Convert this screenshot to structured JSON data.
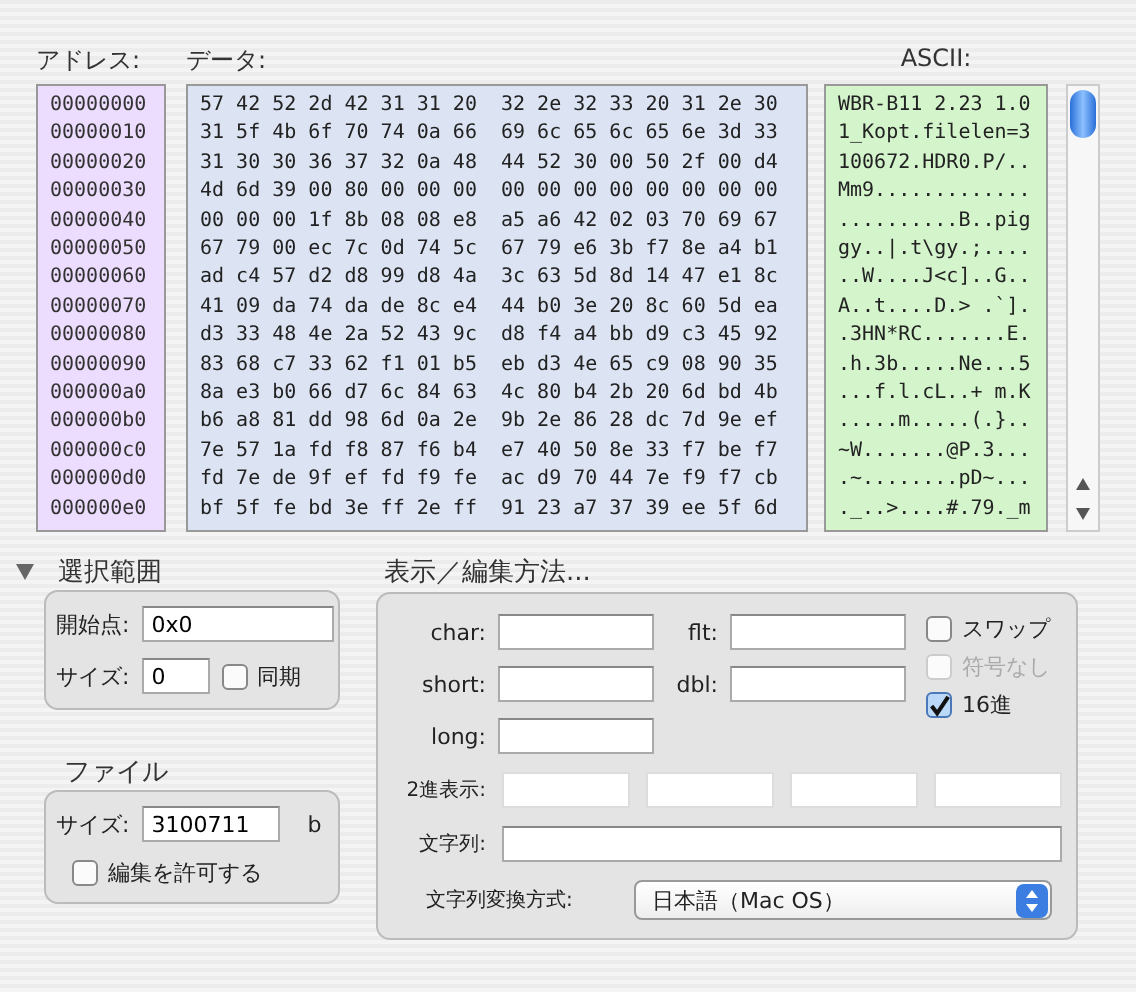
{
  "columns": {
    "address": "アドレス:",
    "data": "データ:",
    "ascii": "ASCII:"
  },
  "rows": [
    {
      "address": "00000000",
      "hex": [
        "57 42 52 2d 42 31 31 20",
        "32 2e 32 33 20 31 2e 30"
      ],
      "ascii": "WBR-B11 2.23 1.0"
    },
    {
      "address": "00000010",
      "hex": [
        "31 5f 4b 6f 70 74 0a 66",
        "69 6c 65 6c 65 6e 3d 33"
      ],
      "ascii": "1_Kopt.filelen=3"
    },
    {
      "address": "00000020",
      "hex": [
        "31 30 30 36 37 32 0a 48",
        "44 52 30 00 50 2f 00 d4"
      ],
      "ascii": "100672.HDR0.P/.."
    },
    {
      "address": "00000030",
      "hex": [
        "4d 6d 39 00 80 00 00 00",
        "00 00 00 00 00 00 00 00"
      ],
      "ascii": "Mm9............."
    },
    {
      "address": "00000040",
      "hex": [
        "00 00 00 1f 8b 08 08 e8",
        "a5 a6 42 02 03 70 69 67"
      ],
      "ascii": "..........B..pig"
    },
    {
      "address": "00000050",
      "hex": [
        "67 79 00 ec 7c 0d 74 5c",
        "67 79 e6 3b f7 8e a4 b1"
      ],
      "ascii": "gy..|.t\\gy.;...."
    },
    {
      "address": "00000060",
      "hex": [
        "ad c4 57 d2 d8 99 d8 4a",
        "3c 63 5d 8d 14 47 e1 8c"
      ],
      "ascii": "..W....J<c]..G.."
    },
    {
      "address": "00000070",
      "hex": [
        "41 09 da 74 da de 8c e4",
        "44 b0 3e 20 8c 60 5d ea"
      ],
      "ascii": "A..t....D.> .`]."
    },
    {
      "address": "00000080",
      "hex": [
        "d3 33 48 4e 2a 52 43 9c",
        "d8 f4 a4 bb d9 c3 45 92"
      ],
      "ascii": ".3HN*RC.......E."
    },
    {
      "address": "00000090",
      "hex": [
        "83 68 c7 33 62 f1 01 b5",
        "eb d3 4e 65 c9 08 90 35"
      ],
      "ascii": ".h.3b.....Ne...5"
    },
    {
      "address": "000000a0",
      "hex": [
        "8a e3 b0 66 d7 6c 84 63",
        "4c 80 b4 2b 20 6d bd 4b"
      ],
      "ascii": "...f.l.cL..+ m.K"
    },
    {
      "address": "000000b0",
      "hex": [
        "b6 a8 81 dd 98 6d 0a 2e",
        "9b 2e 86 28 dc 7d 9e ef"
      ],
      "ascii": ".....m.....(.}.."
    },
    {
      "address": "000000c0",
      "hex": [
        "7e 57 1a fd f8 87 f6 b4",
        "e7 40 50 8e 33 f7 be f7"
      ],
      "ascii": "~W.......@P.3..."
    },
    {
      "address": "000000d0",
      "hex": [
        "fd 7e de 9f ef fd f9 fe",
        "ac d9 70 44 7e f9 f7 cb"
      ],
      "ascii": ".~........pD~..."
    },
    {
      "address": "000000e0",
      "hex": [
        "bf 5f fe bd 3e ff 2e ff",
        "91 23 a7 37 39 ee 5f 6d"
      ],
      "ascii": "._..>....#.79._m"
    }
  ],
  "selection": {
    "title": "選択範囲",
    "expanded": true,
    "start_label": "開始点:",
    "start_value": "0x0",
    "size_label": "サイズ:",
    "size_value": "0",
    "sync": {
      "label": "同期",
      "checked": false
    }
  },
  "file": {
    "title": "ファイル",
    "size_label": "サイズ:",
    "size_value": "3100711",
    "unit": "b",
    "allow_edit": {
      "label": "編集を許可する",
      "checked": false
    }
  },
  "display": {
    "title": "表示／編集方法...",
    "fields": [
      {
        "label": "char:"
      },
      {
        "label": "flt:"
      },
      {
        "label": "short:"
      },
      {
        "label": "dbl:"
      },
      {
        "label": "long:"
      }
    ],
    "options": [
      {
        "label": "スワップ",
        "checked": false,
        "disabled": false
      },
      {
        "label": "符号なし",
        "checked": false,
        "disabled": true
      },
      {
        "label": "16進",
        "checked": true,
        "disabled": false
      }
    ],
    "binary_label": "2進表示:",
    "string_label": "文字列:",
    "encoding_label": "文字列変換方式:",
    "encoding_value": "日本語（Mac OS）"
  }
}
